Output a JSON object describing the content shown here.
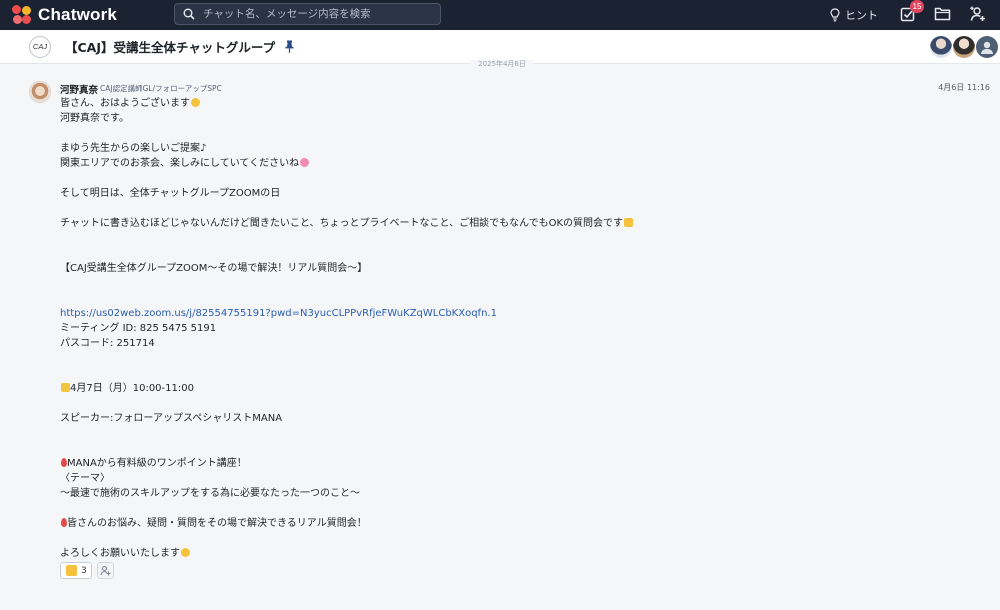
{
  "app": {
    "name": "Chatwork"
  },
  "search": {
    "placeholder": "チャット名、メッセージ内容を検索"
  },
  "header": {
    "hint_label": "ヒント",
    "tasks_badge": "15"
  },
  "room": {
    "icon_text": "CAJ",
    "title": "【CAJ】受講生全体チャットグループ"
  },
  "timeline": {
    "date_label": "2025年4月6日"
  },
  "message": {
    "author": "河野真奈",
    "role": "CAJ認定講師GL/フォローアップSPC",
    "timestamp": "4月6日 11:16",
    "lines": [
      "皆さん、おはようございます",
      "河野真奈です。",
      "",
      "まゆう先生からの楽しいご提案♪",
      "関東エリアでのお茶会、楽しみにしていてくださいね",
      "",
      "そして明日は、全体チャットグループZOOMの日",
      "",
      "チャットに書き込むほどじゃないんだけど聞きたいこと、ちょっとプライベートなこと、ご相談でもなんでもOKの質問会です",
      "",
      "",
      "【CAJ受講生全体グループZOOM〜その場で解決！リアル質問会〜】",
      "",
      "",
      "https://us02web.zoom.us/j/82554755191?pwd=N3yucCLPPvRfjeFWuKZqWLCbKXoqfn.1",
      "ミーティング ID: 825 5475 5191",
      "パスコード: 251714",
      "",
      "",
      "4月7日（月）10:00-11:00",
      "",
      "スピーカー:フォローアップスペシャリストMANA",
      "",
      "",
      "MANAから有料級のワンポイント講座！",
      "〈テーマ〉",
      "〜最速で施術のスキルアップをする為に必要なたった一つのこと〜",
      "",
      "皆さんのお悩み、疑問・質問をその場で解決できるリアル質問会！",
      "",
      "よろしくお願いいたします"
    ],
    "reaction_count": "3"
  },
  "colors": {
    "topbar": "#1b2333",
    "link": "#2a5db0",
    "badge": "#e0455f"
  },
  "icons": {
    "search": "search-icon",
    "hint": "lightbulb-icon",
    "tasks": "checkbox-icon",
    "folder": "folder-icon",
    "contacts": "add-contact-icon",
    "pin": "pin-icon",
    "reaction_add": "add-reaction-icon"
  }
}
